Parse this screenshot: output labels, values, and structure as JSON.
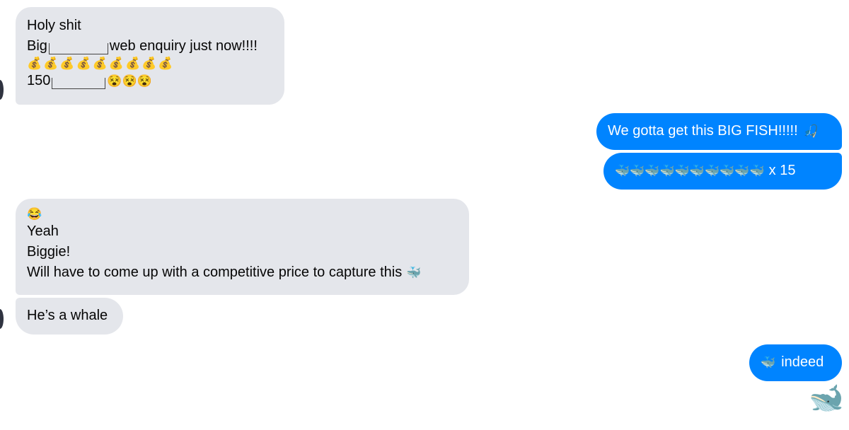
{
  "colors": {
    "incoming_bubble": "#e4e6eb",
    "outgoing_bubble": "#0084ff",
    "incoming_text": "#050505",
    "outgoing_text": "#ffffff"
  },
  "messages": [
    {
      "id": "m1",
      "direction": "incoming",
      "lines": [
        "Holy shit",
        "Big",
        "web enquiry just now!!!!",
        "💰💰💰💰💰💰💰💰💰",
        "150",
        "😵😵😵"
      ],
      "redactions": 2
    },
    {
      "id": "m2",
      "direction": "outgoing",
      "text": "We gotta get this BIG FISH!!!!!",
      "emoji": "🎣"
    },
    {
      "id": "m3",
      "direction": "outgoing",
      "emoji": "🐳🐳🐳🐳🐳🐳🐳🐳🐳🐳",
      "text": "x 15"
    },
    {
      "id": "m4",
      "direction": "incoming",
      "lines": [
        "😂",
        "Yeah",
        "Biggie!",
        "Will have to come up with a competitive price to capture this",
        "🐳"
      ]
    },
    {
      "id": "m5",
      "direction": "incoming",
      "text": "He’s a whale"
    },
    {
      "id": "m6",
      "direction": "outgoing",
      "emoji": "🐳",
      "text": "indeed"
    }
  ],
  "reaction": {
    "emoji": "🐋",
    "icon": "whale-icon"
  }
}
